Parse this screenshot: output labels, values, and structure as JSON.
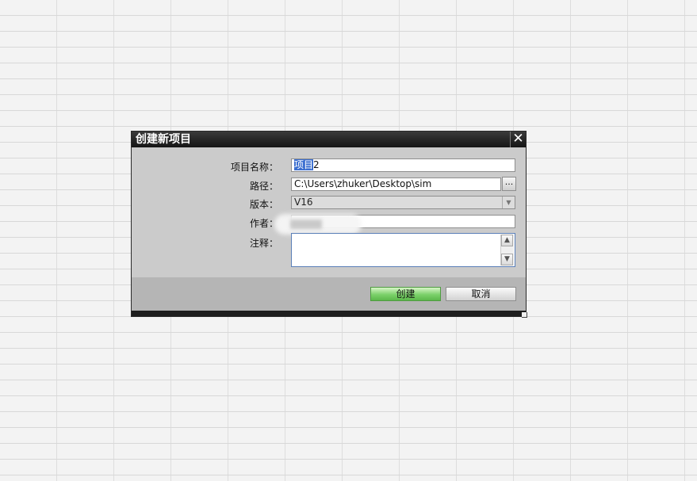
{
  "dialog": {
    "title": "创建新项目",
    "close_glyph": "✕",
    "fields": {
      "project_name": {
        "label": "项目名称：",
        "value_selected": "项目",
        "value_rest": "2"
      },
      "path": {
        "label": "路径：",
        "value": "C:\\Users\\zhuker\\Desktop\\sim",
        "browse_label": "..."
      },
      "version": {
        "label": "版本：",
        "value": "V16",
        "arrow_glyph": "▼"
      },
      "author": {
        "label": "作者：",
        "value": ""
      },
      "comment": {
        "label": "注释：",
        "value": "",
        "up_glyph": "▲",
        "down_glyph": "▼"
      }
    },
    "buttons": {
      "create": "创建",
      "cancel": "取消"
    },
    "icons": {
      "close": "close-icon",
      "browse": "ellipsis-icon",
      "dropdown": "chevron-down-icon",
      "scroll_up": "chevron-up-icon",
      "scroll_down": "chevron-down-icon"
    },
    "colors": {
      "title_bar": "#1f1f1f",
      "body": "#cbcbcb",
      "footer": "#b5b5b5",
      "selection": "#3c6fd0",
      "create_button": "#7bd16a"
    }
  }
}
